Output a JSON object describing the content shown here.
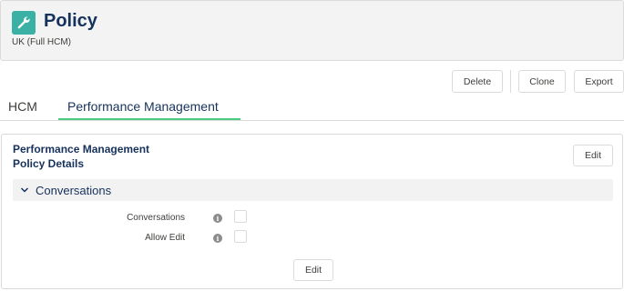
{
  "header": {
    "icon": "wrench-icon",
    "icon_color": "#3bb0a4",
    "title": "Policy",
    "subtitle": "UK (Full HCM)"
  },
  "actions": {
    "delete_label": "Delete",
    "clone_label": "Clone",
    "export_label": "Export"
  },
  "tabs": [
    {
      "label": "HCM",
      "active": false
    },
    {
      "label": "Performance Management",
      "active": true
    }
  ],
  "card": {
    "title_line1": "Performance Management",
    "title_line2": "Policy Details",
    "edit_label": "Edit",
    "section": {
      "label": "Conversations",
      "expanded": true,
      "icon": "chevron-down-icon"
    },
    "fields": [
      {
        "label": "Conversations",
        "checked": false,
        "info_icon": "info-icon"
      },
      {
        "label": "Allow Edit",
        "checked": false,
        "info_icon": "info-icon"
      }
    ],
    "bottom_edit_label": "Edit"
  },
  "colors": {
    "active_tab_underline": "#4bca81",
    "title_text": "#16325c",
    "header_bg": "#f3f3f3"
  }
}
